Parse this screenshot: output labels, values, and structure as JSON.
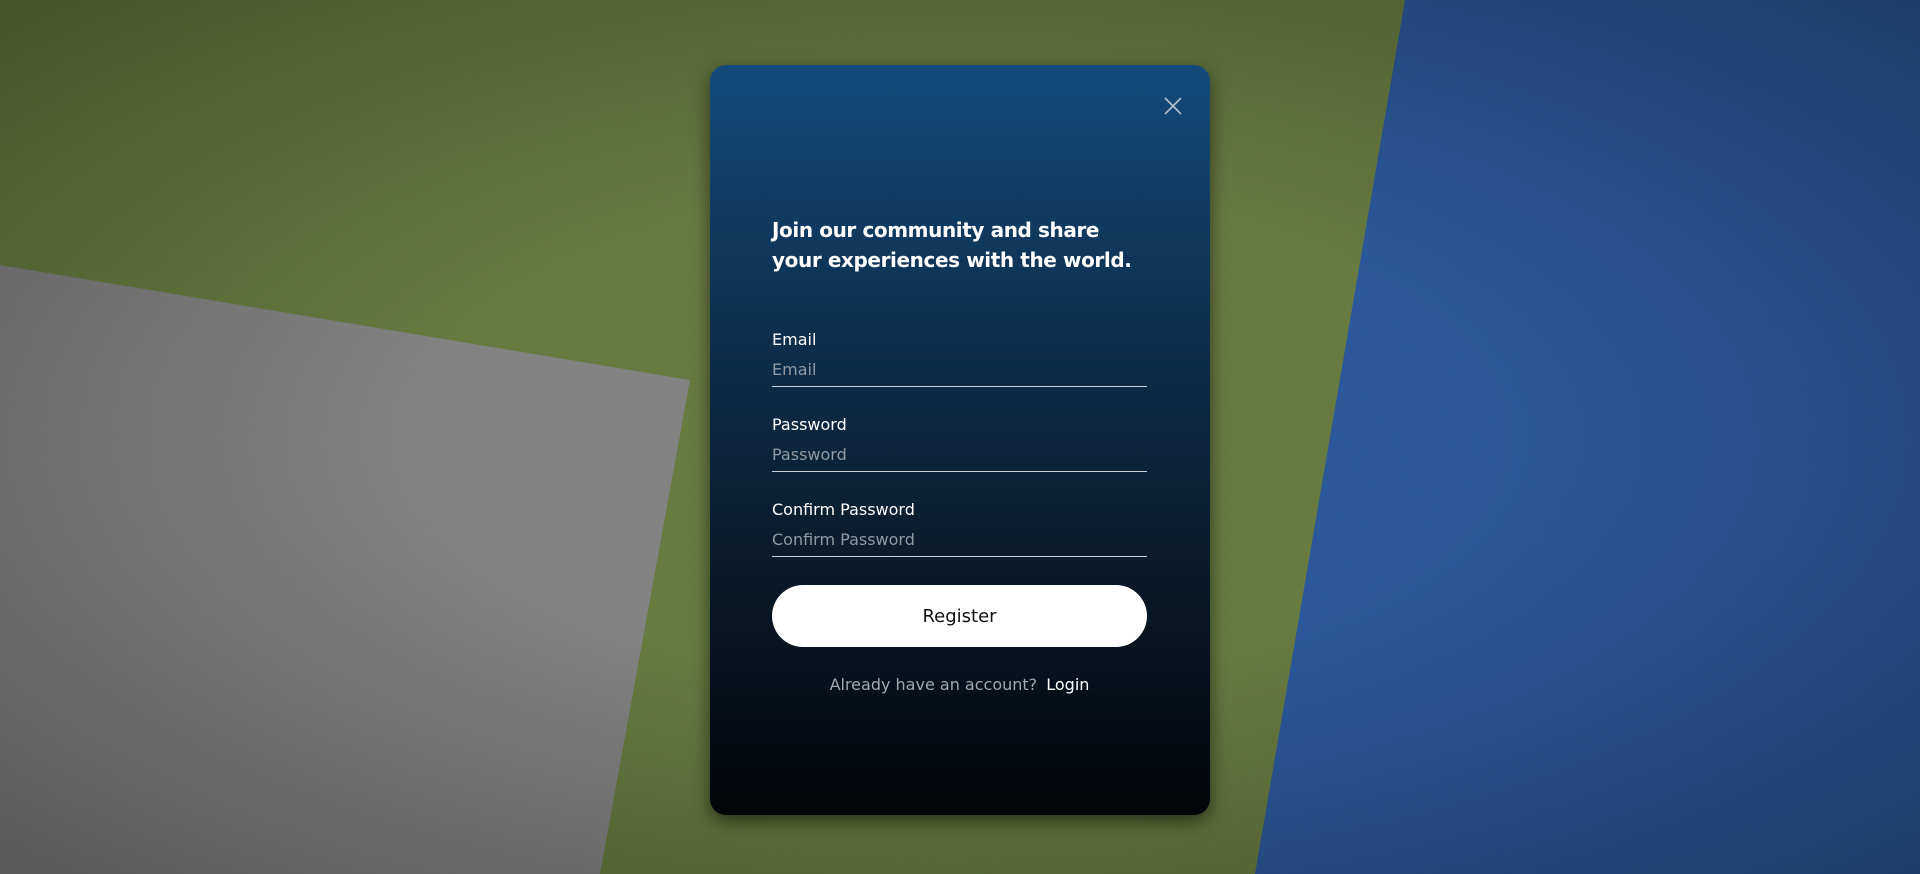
{
  "background": {
    "colors": {
      "felt_green": "#6f8445",
      "paper_gray": "#8c8c8c",
      "felt_blue": "#2f5fa6"
    }
  },
  "modal": {
    "close_icon": "close-icon",
    "headline": "Join our community and share your experiences with the world.",
    "fields": [
      {
        "label": "Email",
        "placeholder": "Email",
        "value": ""
      },
      {
        "label": "Password",
        "placeholder": "Password",
        "value": ""
      },
      {
        "label": "Confirm Password",
        "placeholder": "Confirm Password",
        "value": ""
      }
    ],
    "register_label": "Register",
    "login_prompt": "Already have an account?",
    "login_link": "Login",
    "colors": {
      "gradient_top": "#134b7c",
      "gradient_bottom": "#030508",
      "button_bg": "#ffffff"
    }
  }
}
